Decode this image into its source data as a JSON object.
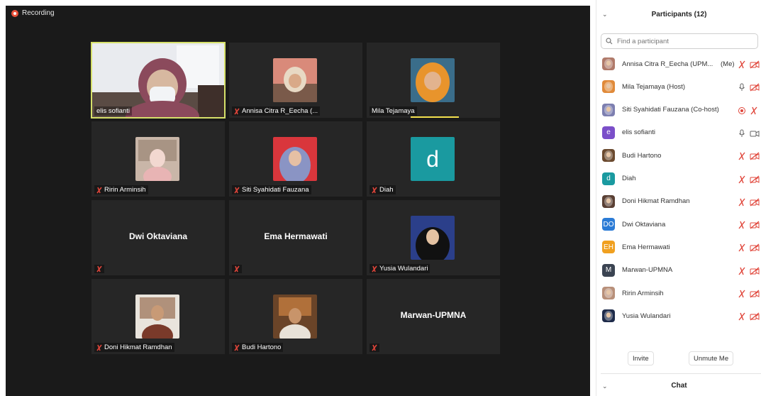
{
  "recording_label": "Recording",
  "participants_panel": {
    "title": "Participants (12)",
    "search_placeholder": "Find a participant",
    "invite_label": "Invite",
    "unmute_label": "Unmute Me",
    "chat_label": "Chat",
    "participants": [
      {
        "name": "Annisa Citra R_Eecha (UPM...",
        "suffix": "(Me)",
        "avatar": "photo",
        "avatar_color": "#b07a6a",
        "mic": "muted",
        "video": "off"
      },
      {
        "name": "Mila Tejamaya (Host)",
        "suffix": "",
        "avatar": "photo",
        "avatar_color": "#e08a3a",
        "mic": "on",
        "video": "off"
      },
      {
        "name": "Siti Syahidati Fauzana (Co-host)",
        "suffix": "",
        "avatar": "photo",
        "avatar_color": "#7d7fb0",
        "mic": "sharing",
        "video": "muted"
      },
      {
        "name": "elis sofianti",
        "suffix": "",
        "avatar": "initial",
        "initials": "e",
        "avatar_color": "#7b4fc9",
        "mic": "on",
        "video": "on"
      },
      {
        "name": "Budi Hartono",
        "suffix": "",
        "avatar": "photo",
        "avatar_color": "#6b4a2f",
        "mic": "muted",
        "video": "off"
      },
      {
        "name": "Diah",
        "suffix": "",
        "avatar": "initial",
        "initials": "d",
        "avatar_color": "#1a9aa0",
        "mic": "muted",
        "video": "off"
      },
      {
        "name": "Doni Hikmat Ramdhan",
        "suffix": "",
        "avatar": "photo",
        "avatar_color": "#5a4034",
        "mic": "muted",
        "video": "off"
      },
      {
        "name": "Dwi Oktaviana",
        "suffix": "",
        "avatar": "initial",
        "initials": "DO",
        "avatar_color": "#2b7bd6",
        "mic": "muted",
        "video": "off"
      },
      {
        "name": "Ema Hermawati",
        "suffix": "",
        "avatar": "initial",
        "initials": "EH",
        "avatar_color": "#f0a020",
        "mic": "muted",
        "video": "off"
      },
      {
        "name": "Marwan-UPMNA",
        "suffix": "",
        "avatar": "initial",
        "initials": "M",
        "avatar_color": "#3b4452",
        "mic": "muted",
        "video": "off"
      },
      {
        "name": "Ririn Arminsih",
        "suffix": "",
        "avatar": "photo",
        "avatar_color": "#b8907a",
        "mic": "muted",
        "video": "off"
      },
      {
        "name": "Yusia Wulandari",
        "suffix": "",
        "avatar": "photo",
        "avatar_color": "#1e2b4a",
        "mic": "muted",
        "video": "off"
      }
    ]
  },
  "gallery": [
    {
      "name": "elis sofianti",
      "type": "video",
      "active": true,
      "muted": false
    },
    {
      "name": "Annisa Citra R_Eecha (...",
      "type": "photo",
      "photo_color": "#c58f70",
      "muted": true
    },
    {
      "name": "Mila Tejamaya",
      "type": "photo",
      "photo_color": "#e59a3c",
      "muted": false,
      "speaking": true
    },
    {
      "name": "Ririn Arminsih",
      "type": "photo",
      "photo_color": "#d9b2a0",
      "muted": true
    },
    {
      "name": "Siti Syahidati Fauzana",
      "type": "photo",
      "photo_color": "#9aa0cf",
      "muted": true
    },
    {
      "name": "Diah",
      "type": "initial",
      "initial": "d",
      "photo_color": "#1a9aa0",
      "muted": true
    },
    {
      "name": "Dwi Oktaviana",
      "type": "name",
      "big_name": "Dwi Oktaviana",
      "muted": true
    },
    {
      "name": "Ema Hermawati",
      "type": "name",
      "big_name": "Ema Hermawati",
      "muted": true
    },
    {
      "name": "Yusia Wulandari",
      "type": "photo",
      "photo_color": "#1f2f55",
      "muted": true
    },
    {
      "name": "Doni Hikmat Ramdhan",
      "type": "photo",
      "photo_color": "#8a5a3a",
      "muted": true
    },
    {
      "name": "Budi Hartono",
      "type": "photo",
      "photo_color": "#7a5530",
      "muted": true
    },
    {
      "name": "Marwan-UPMNA",
      "type": "name",
      "big_name": "Marwan-UPMNA",
      "muted": true
    }
  ]
}
